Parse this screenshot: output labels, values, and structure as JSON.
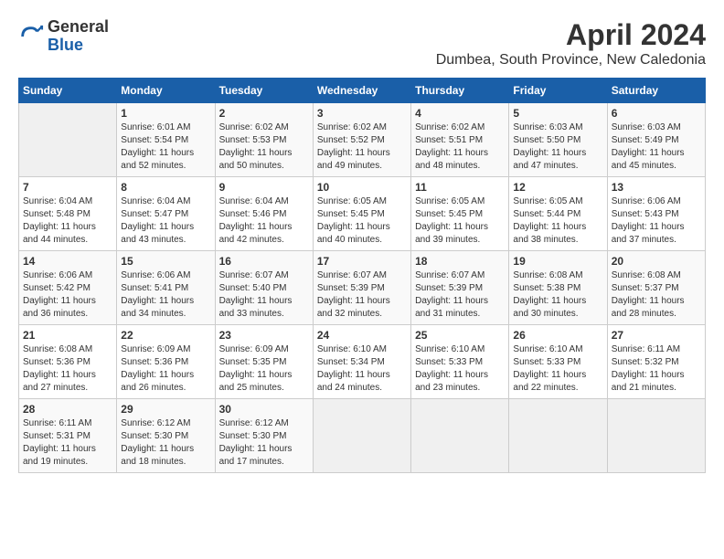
{
  "header": {
    "logo_general": "General",
    "logo_blue": "Blue",
    "title": "April 2024",
    "subtitle": "Dumbea, South Province, New Caledonia"
  },
  "calendar": {
    "days_of_week": [
      "Sunday",
      "Monday",
      "Tuesday",
      "Wednesday",
      "Thursday",
      "Friday",
      "Saturday"
    ],
    "weeks": [
      [
        {
          "day": "",
          "info": ""
        },
        {
          "day": "1",
          "info": "Sunrise: 6:01 AM\nSunset: 5:54 PM\nDaylight: 11 hours\nand 52 minutes."
        },
        {
          "day": "2",
          "info": "Sunrise: 6:02 AM\nSunset: 5:53 PM\nDaylight: 11 hours\nand 50 minutes."
        },
        {
          "day": "3",
          "info": "Sunrise: 6:02 AM\nSunset: 5:52 PM\nDaylight: 11 hours\nand 49 minutes."
        },
        {
          "day": "4",
          "info": "Sunrise: 6:02 AM\nSunset: 5:51 PM\nDaylight: 11 hours\nand 48 minutes."
        },
        {
          "day": "5",
          "info": "Sunrise: 6:03 AM\nSunset: 5:50 PM\nDaylight: 11 hours\nand 47 minutes."
        },
        {
          "day": "6",
          "info": "Sunrise: 6:03 AM\nSunset: 5:49 PM\nDaylight: 11 hours\nand 45 minutes."
        }
      ],
      [
        {
          "day": "7",
          "info": "Sunrise: 6:04 AM\nSunset: 5:48 PM\nDaylight: 11 hours\nand 44 minutes."
        },
        {
          "day": "8",
          "info": "Sunrise: 6:04 AM\nSunset: 5:47 PM\nDaylight: 11 hours\nand 43 minutes."
        },
        {
          "day": "9",
          "info": "Sunrise: 6:04 AM\nSunset: 5:46 PM\nDaylight: 11 hours\nand 42 minutes."
        },
        {
          "day": "10",
          "info": "Sunrise: 6:05 AM\nSunset: 5:45 PM\nDaylight: 11 hours\nand 40 minutes."
        },
        {
          "day": "11",
          "info": "Sunrise: 6:05 AM\nSunset: 5:45 PM\nDaylight: 11 hours\nand 39 minutes."
        },
        {
          "day": "12",
          "info": "Sunrise: 6:05 AM\nSunset: 5:44 PM\nDaylight: 11 hours\nand 38 minutes."
        },
        {
          "day": "13",
          "info": "Sunrise: 6:06 AM\nSunset: 5:43 PM\nDaylight: 11 hours\nand 37 minutes."
        }
      ],
      [
        {
          "day": "14",
          "info": "Sunrise: 6:06 AM\nSunset: 5:42 PM\nDaylight: 11 hours\nand 36 minutes."
        },
        {
          "day": "15",
          "info": "Sunrise: 6:06 AM\nSunset: 5:41 PM\nDaylight: 11 hours\nand 34 minutes."
        },
        {
          "day": "16",
          "info": "Sunrise: 6:07 AM\nSunset: 5:40 PM\nDaylight: 11 hours\nand 33 minutes."
        },
        {
          "day": "17",
          "info": "Sunrise: 6:07 AM\nSunset: 5:39 PM\nDaylight: 11 hours\nand 32 minutes."
        },
        {
          "day": "18",
          "info": "Sunrise: 6:07 AM\nSunset: 5:39 PM\nDaylight: 11 hours\nand 31 minutes."
        },
        {
          "day": "19",
          "info": "Sunrise: 6:08 AM\nSunset: 5:38 PM\nDaylight: 11 hours\nand 30 minutes."
        },
        {
          "day": "20",
          "info": "Sunrise: 6:08 AM\nSunset: 5:37 PM\nDaylight: 11 hours\nand 28 minutes."
        }
      ],
      [
        {
          "day": "21",
          "info": "Sunrise: 6:08 AM\nSunset: 5:36 PM\nDaylight: 11 hours\nand 27 minutes."
        },
        {
          "day": "22",
          "info": "Sunrise: 6:09 AM\nSunset: 5:36 PM\nDaylight: 11 hours\nand 26 minutes."
        },
        {
          "day": "23",
          "info": "Sunrise: 6:09 AM\nSunset: 5:35 PM\nDaylight: 11 hours\nand 25 minutes."
        },
        {
          "day": "24",
          "info": "Sunrise: 6:10 AM\nSunset: 5:34 PM\nDaylight: 11 hours\nand 24 minutes."
        },
        {
          "day": "25",
          "info": "Sunrise: 6:10 AM\nSunset: 5:33 PM\nDaylight: 11 hours\nand 23 minutes."
        },
        {
          "day": "26",
          "info": "Sunrise: 6:10 AM\nSunset: 5:33 PM\nDaylight: 11 hours\nand 22 minutes."
        },
        {
          "day": "27",
          "info": "Sunrise: 6:11 AM\nSunset: 5:32 PM\nDaylight: 11 hours\nand 21 minutes."
        }
      ],
      [
        {
          "day": "28",
          "info": "Sunrise: 6:11 AM\nSunset: 5:31 PM\nDaylight: 11 hours\nand 19 minutes."
        },
        {
          "day": "29",
          "info": "Sunrise: 6:12 AM\nSunset: 5:30 PM\nDaylight: 11 hours\nand 18 minutes."
        },
        {
          "day": "30",
          "info": "Sunrise: 6:12 AM\nSunset: 5:30 PM\nDaylight: 11 hours\nand 17 minutes."
        },
        {
          "day": "",
          "info": ""
        },
        {
          "day": "",
          "info": ""
        },
        {
          "day": "",
          "info": ""
        },
        {
          "day": "",
          "info": ""
        }
      ]
    ]
  }
}
